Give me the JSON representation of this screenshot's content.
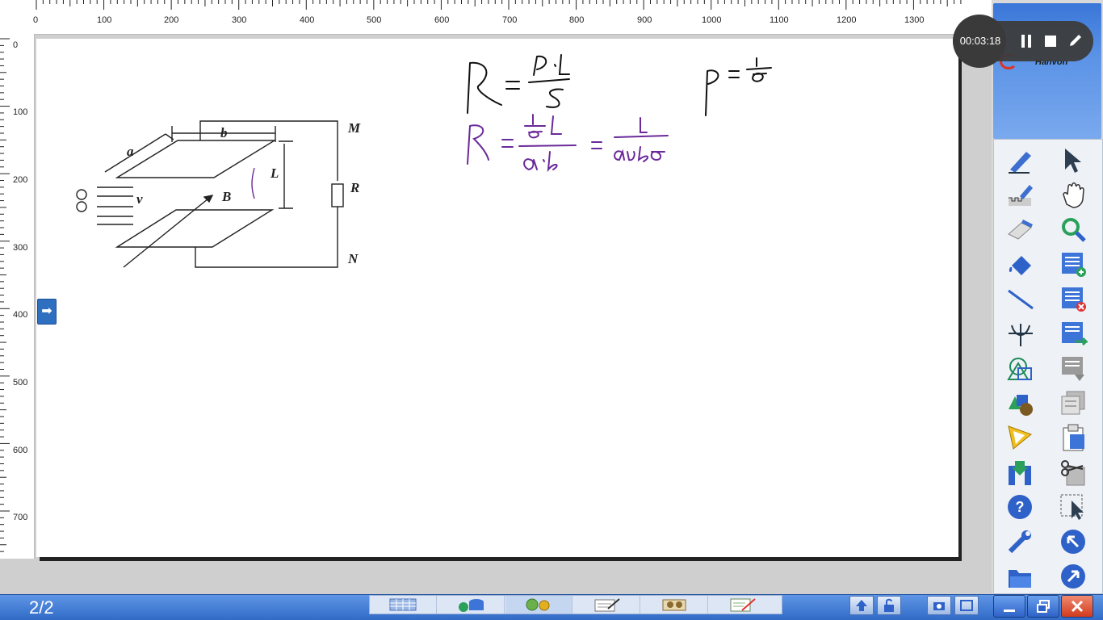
{
  "ruler": {
    "h_labels": [
      "0",
      "100",
      "200",
      "300",
      "400",
      "500",
      "600",
      "700",
      "800",
      "900",
      "1000",
      "1100",
      "1200",
      "1300"
    ],
    "v_labels": [
      "0",
      "100",
      "200",
      "300",
      "400",
      "500",
      "600",
      "700"
    ]
  },
  "recorder": {
    "time": "00:03:18"
  },
  "brand": {
    "name": "Hanvon"
  },
  "taskbar": {
    "page": "2/2"
  },
  "diagram": {
    "labels": {
      "a": "a",
      "b": "b",
      "L": "L",
      "M": "M",
      "R": "R",
      "N": "N",
      "B": "B",
      "v": "v"
    }
  },
  "toolbar": {
    "left": [
      "pen-icon",
      "highlighter-icon",
      "eraser-icon",
      "fill-bucket-icon",
      "line-icon",
      "axis-icon",
      "shapes-icon",
      "solid-shapes-icon",
      "triangle-ruler-icon",
      "import-icon",
      "help-icon",
      "settings-wrench-icon",
      "folder-icon"
    ],
    "right": [
      "select-arrow-icon",
      "hand-pan-icon",
      "magnifier-icon",
      "add-page-icon",
      "delete-page-icon",
      "page-back-icon",
      "page-gray-icon",
      "page-copy-icon",
      "clipboard-icon",
      "cut-icon",
      "area-select-icon",
      "prev-nav-icon",
      "next-nav-icon"
    ]
  },
  "colors": {
    "panel_blue": "#3a76d8",
    "taskbar_blue": "#2f69c6",
    "ink_purple": "#6a2a9a",
    "ink_black": "#111111"
  }
}
